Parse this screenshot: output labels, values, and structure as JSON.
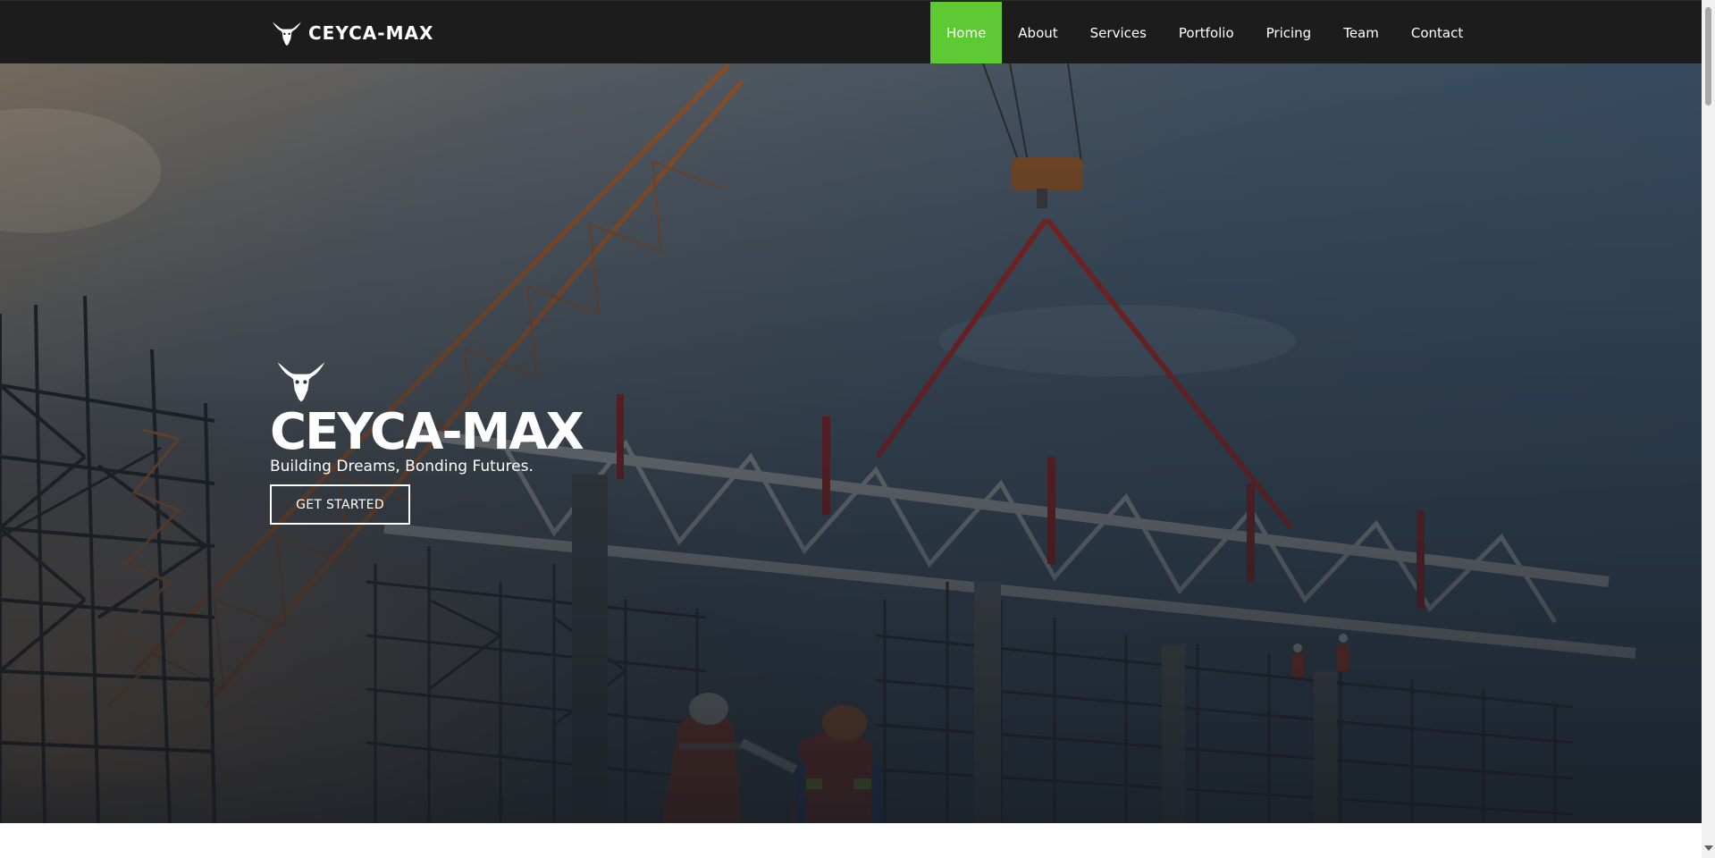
{
  "brand": {
    "name": "CEYCA-MAX",
    "logo_icon": "goat-skull-icon"
  },
  "nav": {
    "items": [
      {
        "label": "Home",
        "active": true
      },
      {
        "label": "About",
        "active": false
      },
      {
        "label": "Services",
        "active": false
      },
      {
        "label": "Portfolio",
        "active": false
      },
      {
        "label": "Pricing",
        "active": false
      },
      {
        "label": "Team",
        "active": false
      },
      {
        "label": "Contact",
        "active": false
      }
    ]
  },
  "hero": {
    "logo_icon": "goat-skull-icon",
    "title": "CEYCA-MAX",
    "subtitle": "Building Dreams, Bonding Futures.",
    "cta_label": "GET STARTED",
    "background_image": "construction-site-crane-steel-truss-workers-icon"
  },
  "colors": {
    "navbar": "#1c1c1c",
    "accent": "#5dca33",
    "text": "#ffffff"
  }
}
